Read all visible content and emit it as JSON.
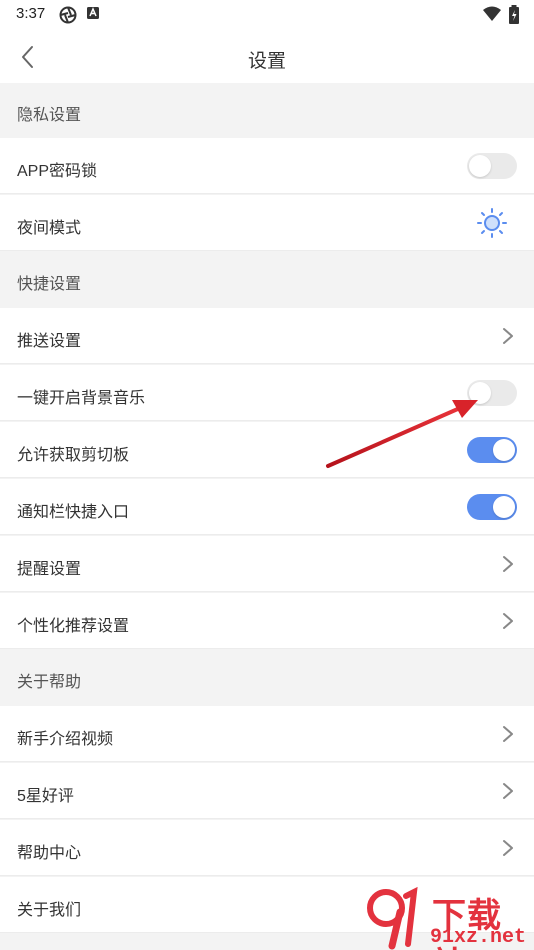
{
  "status_bar": {
    "time": "3:37"
  },
  "header": {
    "title": "设置"
  },
  "sections": [
    {
      "title": "隐私设置",
      "rows": [
        {
          "label": "APP密码锁",
          "control": "toggle",
          "on": false
        },
        {
          "label": "夜间模式",
          "control": "sun-icon"
        }
      ]
    },
    {
      "title": "快捷设置",
      "rows": [
        {
          "label": "推送设置",
          "control": "chevron"
        },
        {
          "label": "一键开启背景音乐",
          "control": "toggle",
          "on": false
        },
        {
          "label": "允许获取剪切板",
          "control": "toggle",
          "on": true
        },
        {
          "label": "通知栏快捷入口",
          "control": "toggle",
          "on": true
        },
        {
          "label": "提醒设置",
          "control": "chevron"
        },
        {
          "label": "个性化推荐设置",
          "control": "chevron"
        }
      ]
    },
    {
      "title": "关于帮助",
      "rows": [
        {
          "label": "新手介绍视频",
          "control": "chevron"
        },
        {
          "label": "5星好评",
          "control": "chevron"
        },
        {
          "label": "帮助中心",
          "control": "chevron"
        },
        {
          "label": "关于我们",
          "control": "chevron"
        }
      ]
    }
  ],
  "watermark": {
    "text_main": "下载站",
    "text_sub": "91xz.net"
  },
  "colors": {
    "toggle_on": "#5b8def",
    "toggle_off": "#eaeaea",
    "annotation_arrow": "#d8232a",
    "sun_icon": "#5b8def"
  }
}
